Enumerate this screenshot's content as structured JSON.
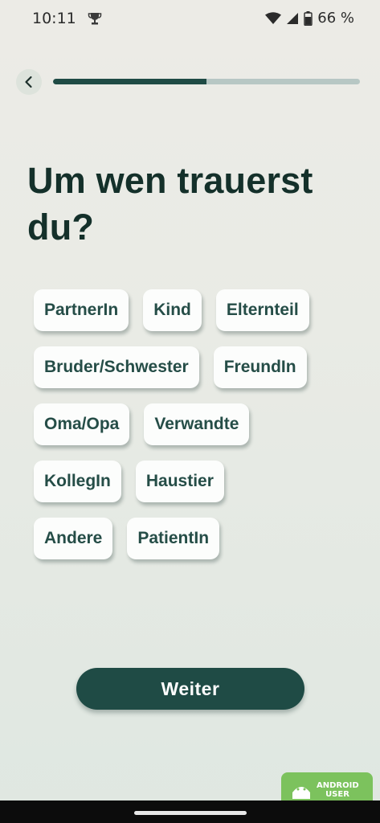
{
  "status_bar": {
    "time": "10:11",
    "battery": "66 %",
    "icons": [
      "trophy-icon",
      "wifi-icon",
      "signal-icon",
      "battery-icon"
    ]
  },
  "progress": {
    "value": 0.5,
    "back_icon": "chevron-left-icon"
  },
  "question": {
    "title": "Um wen trauerst du?"
  },
  "options": [
    [
      "PartnerIn",
      "Kind",
      "Elternteil"
    ],
    [
      "Bruder/Schwester",
      "FreundIn"
    ],
    [
      "Oma/Opa",
      "Verwandte"
    ],
    [
      "KollegIn",
      "Haustier"
    ],
    [
      "Andere",
      "PatientIn"
    ]
  ],
  "actions": {
    "continue_label": "Weiter"
  },
  "watermark": {
    "text": "ANDROID USER"
  },
  "colors": {
    "accent": "#1f4b45",
    "chip_text": "#254d47",
    "title": "#14302a",
    "progress_track": "#b7c7c4",
    "watermark": "#7cc25d"
  }
}
